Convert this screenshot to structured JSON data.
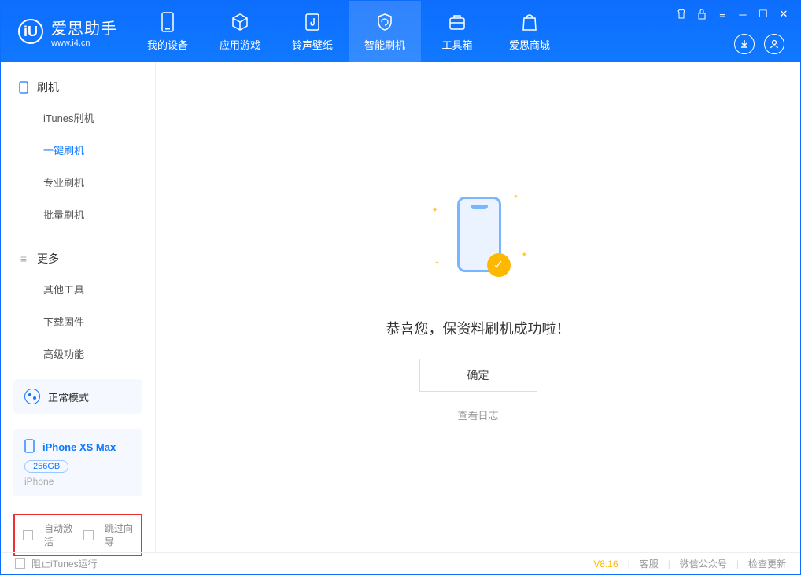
{
  "app": {
    "name": "爱思助手",
    "url": "www.i4.cn"
  },
  "nav": [
    {
      "label": "我的设备"
    },
    {
      "label": "应用游戏"
    },
    {
      "label": "铃声壁纸"
    },
    {
      "label": "智能刷机"
    },
    {
      "label": "工具箱"
    },
    {
      "label": "爱思商城"
    }
  ],
  "sidebar": {
    "section1": {
      "title": "刷机",
      "items": [
        "iTunes刷机",
        "一键刷机",
        "专业刷机",
        "批量刷机"
      ]
    },
    "section2": {
      "title": "更多",
      "items": [
        "其他工具",
        "下载固件",
        "高级功能"
      ]
    }
  },
  "device": {
    "mode": "正常模式",
    "name": "iPhone XS Max",
    "storage": "256GB",
    "type": "iPhone"
  },
  "options": {
    "auto_activate": "自动激活",
    "skip_guide": "跳过向导"
  },
  "main": {
    "success": "恭喜您，保资料刷机成功啦！",
    "confirm": "确定",
    "view_log": "查看日志"
  },
  "footer": {
    "block_itunes": "阻止iTunes运行",
    "version": "V8.16",
    "support": "客服",
    "wechat": "微信公众号",
    "update": "检查更新"
  }
}
